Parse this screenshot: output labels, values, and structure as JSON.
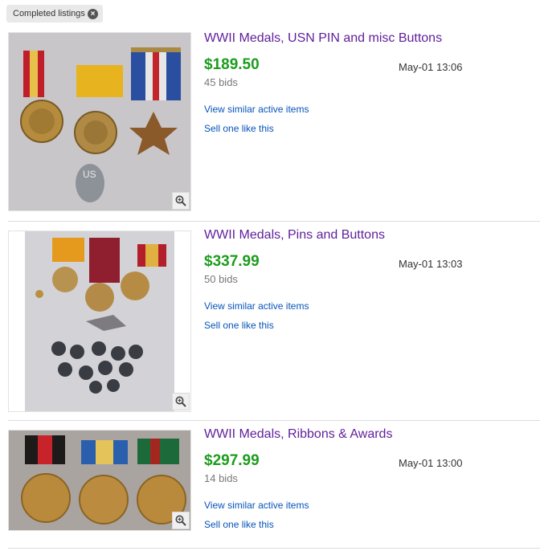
{
  "filter_chip": {
    "label": "Completed listings",
    "close_icon": "close-icon"
  },
  "listings": [
    {
      "title": "WWII Medals, USN PIN and misc Buttons",
      "price": "$189.50",
      "bids": "45 bids",
      "date": "May-01 13:06",
      "view_similar": "View similar active items",
      "sell_one": "Sell one like this",
      "zoom_icon": "zoom-in-icon"
    },
    {
      "title": "WWII Medals, Pins and Buttons",
      "price": "$337.99",
      "bids": "50 bids",
      "date": "May-01 13:03",
      "view_similar": "View similar active items",
      "sell_one": "Sell one like this",
      "zoom_icon": "zoom-in-icon"
    },
    {
      "title": "WWII Medals, Ribbons & Awards",
      "price": "$297.99",
      "bids": "14 bids",
      "date": "May-01 13:00",
      "view_similar": "View similar active items",
      "sell_one": "Sell one like this",
      "zoom_icon": "zoom-in-icon"
    }
  ],
  "colors": {
    "title_link": "#5f1e9a",
    "price": "#1c9c1c",
    "action_link": "#0654ba"
  }
}
